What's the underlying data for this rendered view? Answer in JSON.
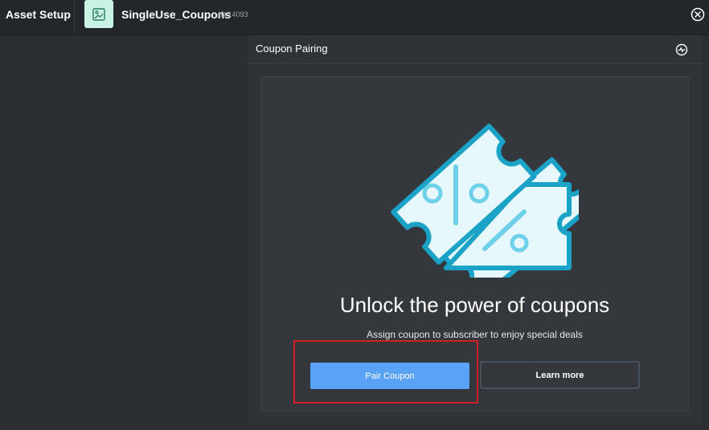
{
  "topbar": {
    "app_title": "Asset Setup",
    "asset_name": "SingleUse_Coupons",
    "asset_id": "ID 14093",
    "asset_icon": "image-icon",
    "close_icon": "close-circle-icon"
  },
  "panel": {
    "title": "Coupon Pairing",
    "action_icon": "activity-pulse-icon"
  },
  "card": {
    "illustration": "coupon-tickets-icon",
    "headline": "Unlock the power of coupons",
    "subtext": "Assign coupon to subscriber to enjoy special deals",
    "primary_button": "Pair Coupon",
    "secondary_button": "Learn more"
  },
  "colors": {
    "background": "#2b2f33",
    "topbar": "#23272b",
    "panel": "#2f3337",
    "card": "#34383c",
    "primary": "#5aa2f6",
    "ticket_fill": "#e6f8fc",
    "ticket_stroke": "#1ba2c7",
    "ticket_accent": "#6fd0ea",
    "highlight": "#d31f26"
  }
}
